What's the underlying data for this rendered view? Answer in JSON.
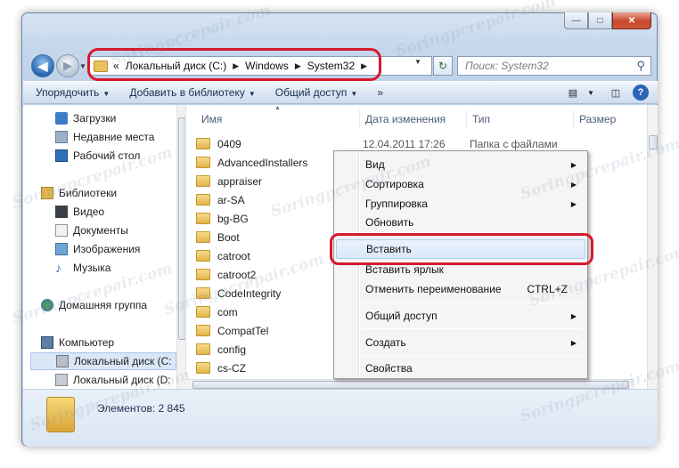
{
  "window": {
    "caption_min": "—",
    "caption_max": "□",
    "caption_close": "✕"
  },
  "nav": {
    "back_glyph": "◀",
    "fwd_glyph": "▶",
    "history_glyph": "▼"
  },
  "address": {
    "overflow": "«",
    "crumbs": [
      "Локальный диск (C:)",
      "Windows",
      "System32"
    ],
    "sep_glyph": "▶",
    "dropdown_glyph": "▼",
    "refresh_glyph": "↻"
  },
  "search": {
    "placeholder": "Поиск: System32",
    "icon_glyph": "🔍"
  },
  "toolbar": {
    "items": [
      "Упорядочить",
      "Добавить в библиотеку",
      "Общий доступ"
    ],
    "more": "»",
    "arrow": "▼"
  },
  "sidebar": {
    "items": [
      {
        "label": "Загрузки",
        "icon": "downloads-icon"
      },
      {
        "label": "Недавние места",
        "icon": "recent-places-icon"
      },
      {
        "label": "Рабочий стол",
        "icon": "desktop-icon"
      },
      {
        "label": "Библиотеки",
        "icon": "libraries-icon"
      },
      {
        "label": "Видео",
        "icon": "video-icon"
      },
      {
        "label": "Документы",
        "icon": "documents-icon"
      },
      {
        "label": "Изображения",
        "icon": "pictures-icon"
      },
      {
        "label": "Музыка",
        "icon": "music-icon"
      },
      {
        "label": "Домашняя группа",
        "icon": "homegroup-icon"
      },
      {
        "label": "Компьютер",
        "icon": "computer-icon"
      },
      {
        "label": "Локальный диск (C:",
        "icon": "drive-c-icon"
      },
      {
        "label": "Локальный диск (D:",
        "icon": "drive-d-icon"
      }
    ]
  },
  "columns": {
    "name": "Имя",
    "date": "Дата изменения",
    "type": "Тип",
    "size": "Размер",
    "sort_glyph": "▲"
  },
  "files": [
    {
      "name": "0409",
      "date": "12.04.2011 17:26",
      "type": "Папка с файлами"
    },
    {
      "name": "AdvancedInstallers"
    },
    {
      "name": "appraiser"
    },
    {
      "name": "ar-SA"
    },
    {
      "name": "bg-BG"
    },
    {
      "name": "Boot"
    },
    {
      "name": "catroot"
    },
    {
      "name": "catroot2"
    },
    {
      "name": "CodeIntegrity"
    },
    {
      "name": "com"
    },
    {
      "name": "CompatTel"
    },
    {
      "name": "config"
    },
    {
      "name": "cs-CZ"
    }
  ],
  "status": {
    "count": "Элементов: 2 845"
  },
  "context_menu": {
    "items": [
      {
        "label": "Вид",
        "submenu": true
      },
      {
        "label": "Сортировка",
        "submenu": true
      },
      {
        "label": "Группировка",
        "submenu": true
      },
      {
        "label": "Обновить"
      },
      {
        "label": "Вставить",
        "highlighted": true
      },
      {
        "label": "Вставить ярлык"
      },
      {
        "label": "Отменить переименование",
        "shortcut": "CTRL+Z"
      },
      {
        "label": "Общий доступ",
        "submenu": true
      },
      {
        "label": "Создать",
        "submenu": true
      },
      {
        "label": "Свойства"
      }
    ],
    "submenu_glyph": "▶"
  },
  "watermark": "Soringpcrepair.com",
  "colors": {
    "highlight_red": "#d6192d",
    "accent_blue": "#2b66ad",
    "folder_yellow": "#e2b54a"
  }
}
